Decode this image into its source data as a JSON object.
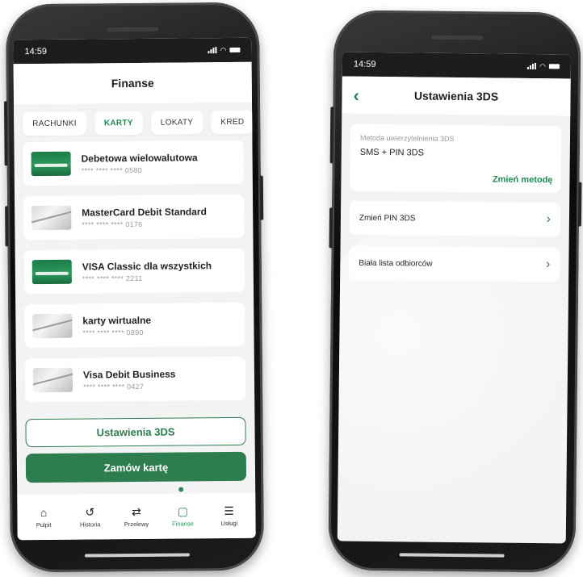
{
  "left_phone": {
    "status_time": "14:59",
    "title": "Finanse",
    "tabs": [
      {
        "label": "RACHUNKI"
      },
      {
        "label": "KARTY"
      },
      {
        "label": "LOKATY"
      },
      {
        "label": "KRED"
      }
    ],
    "cards": [
      {
        "name": "Debetowa wielowalutowa",
        "number": "**** **** **** 0580",
        "style": "green"
      },
      {
        "name": "MasterCard Debit Standard",
        "number": "**** **** **** 0176",
        "style": "silver"
      },
      {
        "name": "VISA Classic dla wszystkich",
        "number": "**** **** **** 2211",
        "style": "green"
      },
      {
        "name": "karty wirtualne",
        "number": "**** **** **** 0890",
        "style": "silver"
      },
      {
        "name": "Visa Debit Business",
        "number": "**** **** **** 0427",
        "style": "silver"
      }
    ],
    "settings_button": "Ustawienia 3DS",
    "order_button": "Zamów kartę",
    "nav": [
      {
        "label": "Pulpit",
        "icon": "home-icon",
        "glyph": "⌂"
      },
      {
        "label": "Historia",
        "icon": "history-icon",
        "glyph": "↺"
      },
      {
        "label": "Przelewy",
        "icon": "transfer-icon",
        "glyph": "⇄"
      },
      {
        "label": "Finanse",
        "icon": "wallet-icon",
        "glyph": "▢"
      },
      {
        "label": "Usługi",
        "icon": "database-icon",
        "glyph": "☰"
      }
    ],
    "active_nav": "Finanse",
    "accent_color": "#2e7d4f"
  },
  "right_phone": {
    "status_time": "14:59",
    "title": "Ustawienia 3DS",
    "back_glyph": "‹",
    "method_label": "Metoda uwierzytelnienia 3DS",
    "method_value": "SMS + PIN 3DS",
    "change_method": "Zmień metodę",
    "rows": [
      {
        "label": "Zmień PIN 3DS"
      },
      {
        "label": "Biała lista odbiorców"
      }
    ],
    "chevron_glyph": "›"
  }
}
